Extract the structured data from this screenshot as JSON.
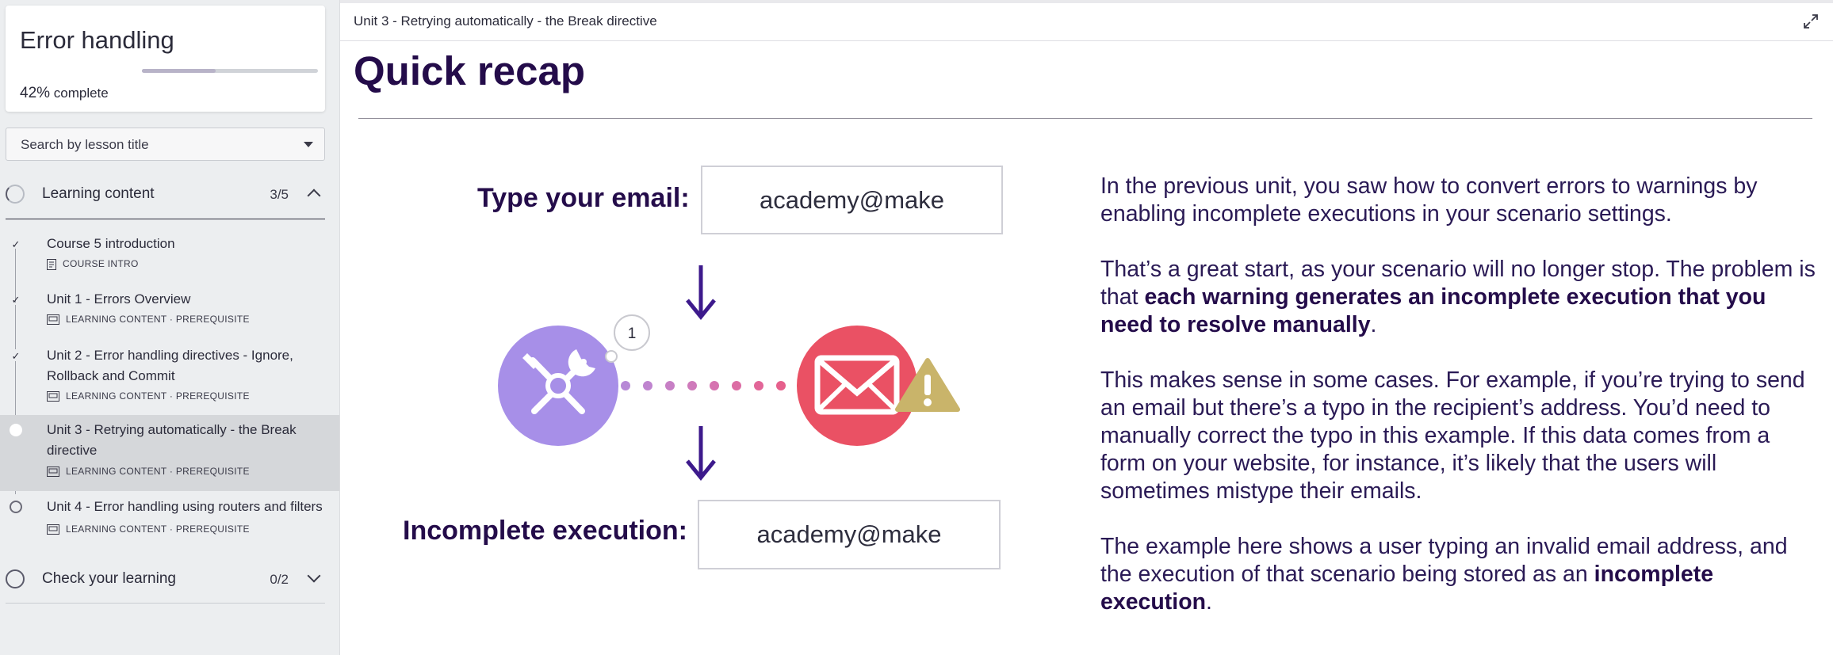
{
  "sidebar": {
    "course_title": "Error handling",
    "progress_value": "42%",
    "progress_suffix": " complete",
    "progress_fraction": 0.42,
    "search_placeholder": "Search by lesson title",
    "sections": [
      {
        "label": "Learning content",
        "count": "3/5",
        "lessons": [
          {
            "title": "Course 5 introduction",
            "meta": "COURSE INTRO",
            "status": "done"
          },
          {
            "title": "Unit 1 - Errors Overview",
            "meta": "LEARNING CONTENT · PREREQUISITE",
            "status": "done"
          },
          {
            "title": "Unit 2 - Error handling directives - Ignore, Rollback and Commit",
            "meta": "LEARNING CONTENT · PREREQUISITE",
            "status": "done"
          },
          {
            "title": "Unit 3 - Retrying automatically - the Break directive",
            "meta": "LEARNING CONTENT · PREREQUISITE",
            "status": "current"
          },
          {
            "title": "Unit 4 - Error handling using routers and filters",
            "meta": "LEARNING CONTENT · PREREQUISITE",
            "status": "todo"
          }
        ]
      },
      {
        "label": "Check your learning",
        "count": "0/2"
      }
    ]
  },
  "header": {
    "breadcrumb": "Unit 3 - Retrying automatically - the Break directive"
  },
  "main": {
    "title": "Quick recap",
    "diagram": {
      "email_label": "Type your email:",
      "email_value": "academy@make",
      "badge_count": "1",
      "incomplete_label": "Incomplete execution:",
      "incomplete_value": "academy@make"
    },
    "paragraphs": {
      "p1": "In the previous unit, you saw how to convert errors to warnings by enabling incomplete executions in your scenario settings.",
      "p2_a": "That’s a great start, as your scenario will no longer stop. The problem is that ",
      "p2_b": "each warning generates an incomplete execution that you need to resolve manually",
      "p2_c": ".",
      "p3": "This makes sense in some cases. For example, if you’re trying to send an email but there’s a typo in the recipient’s address. You’d need to manually correct the typo in this example. If this data comes from a form on your website, for instance, it’s likely that the users will sometimes mistype their emails.",
      "p4_a": "The example here shows a user typing an invalid email address, and the execution of that scenario being stored as an ",
      "p4_b": "incomplete execution",
      "p4_c": "."
    }
  },
  "colors": {
    "brand_dark": "#240c4a",
    "tools_module": "#a78fe8",
    "email_module": "#ea5164",
    "warning": "#c9b46a",
    "arrow": "#3d1a8c"
  }
}
